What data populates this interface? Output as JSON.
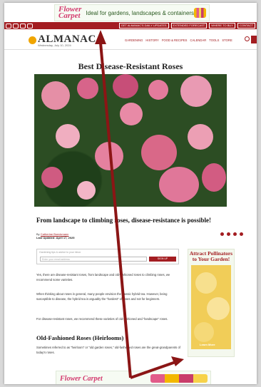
{
  "ad_top": {
    "brand": "Flower Carpet",
    "tagline": "Ideal for gardens, landscapes & containers"
  },
  "nav": {
    "logo": "ALMANAC",
    "date": "Wednesday, July 10, 2024",
    "menu": [
      "GARDENING",
      "HISTORY",
      "FOOD & RECIPES",
      "CALENDAR",
      "TOOLS",
      "STORE"
    ],
    "util_links": [
      "GET ALMANAC'S DAILY UPDATES",
      "EXTENDED FORECAST",
      "WHERE TO BUY",
      "CONTACT"
    ]
  },
  "article": {
    "title": "Best Disease-Resistant Roses",
    "subheading": "From landscape to climbing roses, disease-resistance is possible!",
    "by": "By",
    "author": "Catherine Boeckmann",
    "updated": "Last Updated: April 17, 2025",
    "signup_label": "Gardening tips & advice to your inbox",
    "email_placeholder": "Enter your email address",
    "signup_button": "SIGN UP",
    "paragraphs": [
      "Yes, there are disease-resistant roses, from landscape and old-fashioned roses to climbing roses, we recommend some varieties.",
      "When thinking about roses in general, many people envision the classic hybrid tea. However, being susceptible to disease, the hybrid tea is arguably the \"hardest\" of roses and not for beginners.",
      "For disease-resistant roses, we recommend these varieties of old-fashioned and \"landscape\" roses."
    ],
    "section_heading": "Old-Fashioned Roses (Heirlooms)",
    "section_text": "Sometimes referred to as \"heirloom\" or \"old garden roses,\" old-fashioned roses are the great-grandparents of today's roses."
  },
  "side_ad": {
    "title": "Attract Pollinators to Your Garden!",
    "cta": "Learn More"
  },
  "ad_bottom": {
    "brand": "Flower Carpet"
  },
  "colors": {
    "accent": "#a31d21",
    "pink": "#d33a6e",
    "annotation_arrow": "#8b1515"
  }
}
